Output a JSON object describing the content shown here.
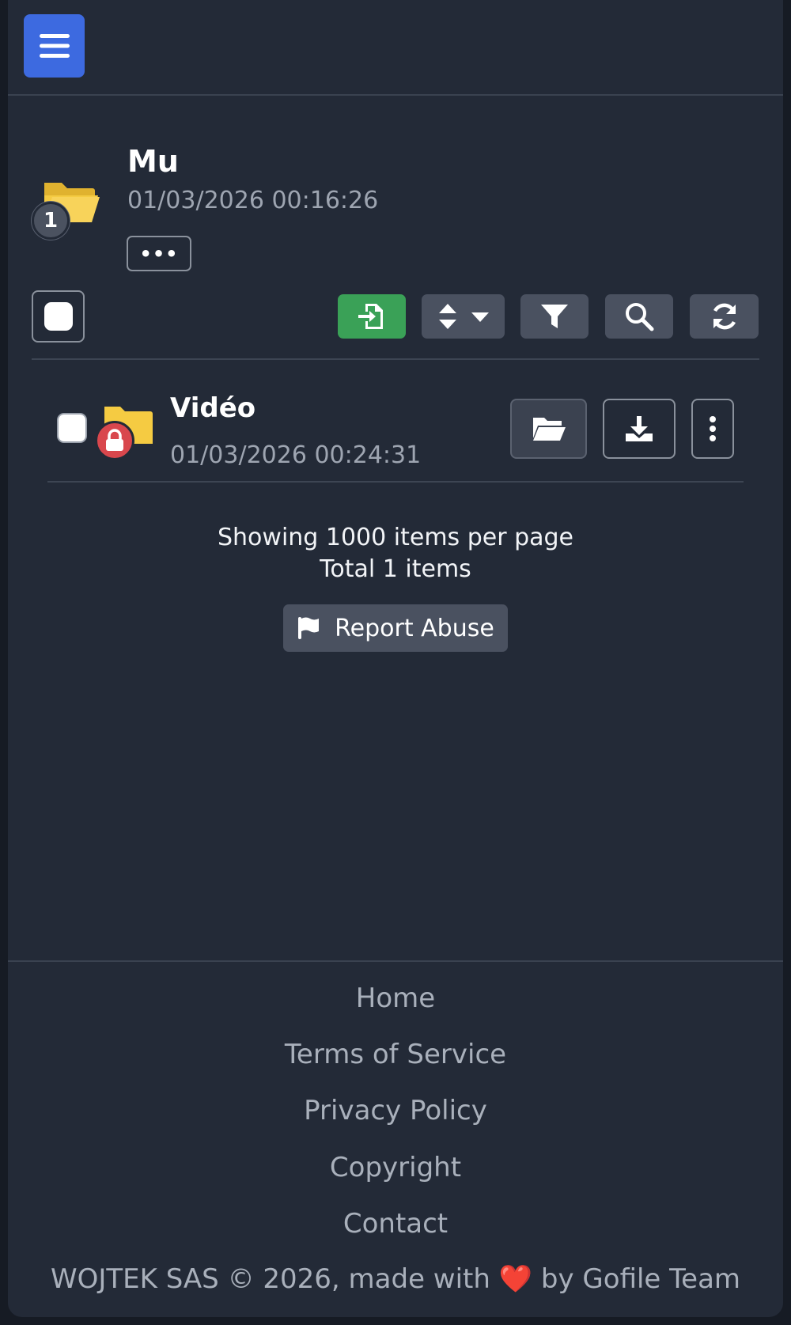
{
  "folder": {
    "title": "Mu",
    "date": "01/03/2026 00:16:26",
    "children_count": "1",
    "more_label": "•••"
  },
  "items": [
    {
      "name": "Vidéo",
      "date": "01/03/2026 00:24:31",
      "locked": true
    }
  ],
  "list_info": {
    "per_page": "Showing 1000 items per page",
    "total": "Total 1 items"
  },
  "report_label": "Report Abuse",
  "footer": {
    "links": [
      "Home",
      "Terms of Service",
      "Privacy Policy",
      "Copyright",
      "Contact"
    ],
    "copyright_pre": "WOJTEK SAS © 2026, made with",
    "heart": "❤️",
    "copyright_post": "by Gofile Team"
  },
  "colors": {
    "accent": "#3d6ae0",
    "success": "#3aa157",
    "danger": "#d9474d",
    "folder": "#f5cb42"
  }
}
